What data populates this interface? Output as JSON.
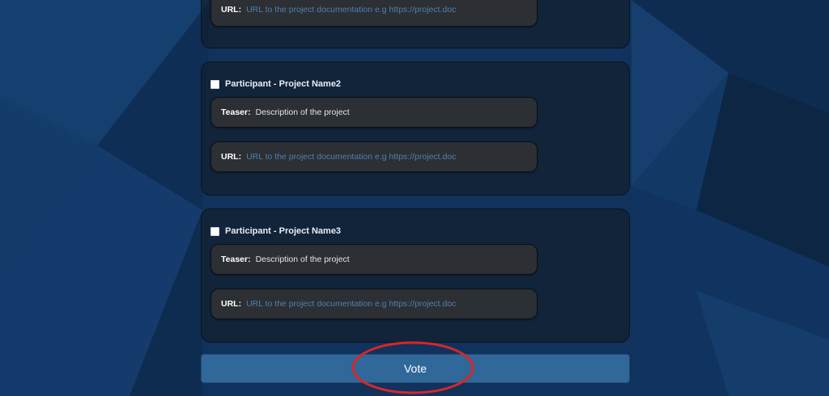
{
  "colors": {
    "background": "#0f2f57",
    "card": "#121e2e",
    "field": "#2c2f33",
    "placeholder": "#4f80ae",
    "vote_button": "#2f6899",
    "highlight_ellipse": "#d8262a"
  },
  "top_card": {
    "url_label": "URL:",
    "url_placeholder": "URL to the project documentation e.g https://project.doc"
  },
  "projects": [
    {
      "participant_label": "Participant - Project Name2",
      "checked": false,
      "teaser_label": "Teaser:",
      "teaser_value": "Description of the project",
      "url_label": "URL:",
      "url_placeholder": "URL to the project documentation e.g https://project.doc"
    },
    {
      "participant_label": "Participant - Project Name3",
      "checked": false,
      "teaser_label": "Teaser:",
      "teaser_value": "Description of the project",
      "url_label": "URL:",
      "url_placeholder": "URL to the project documentation e.g https://project.doc"
    }
  ],
  "vote_button": {
    "label": "Vote"
  }
}
